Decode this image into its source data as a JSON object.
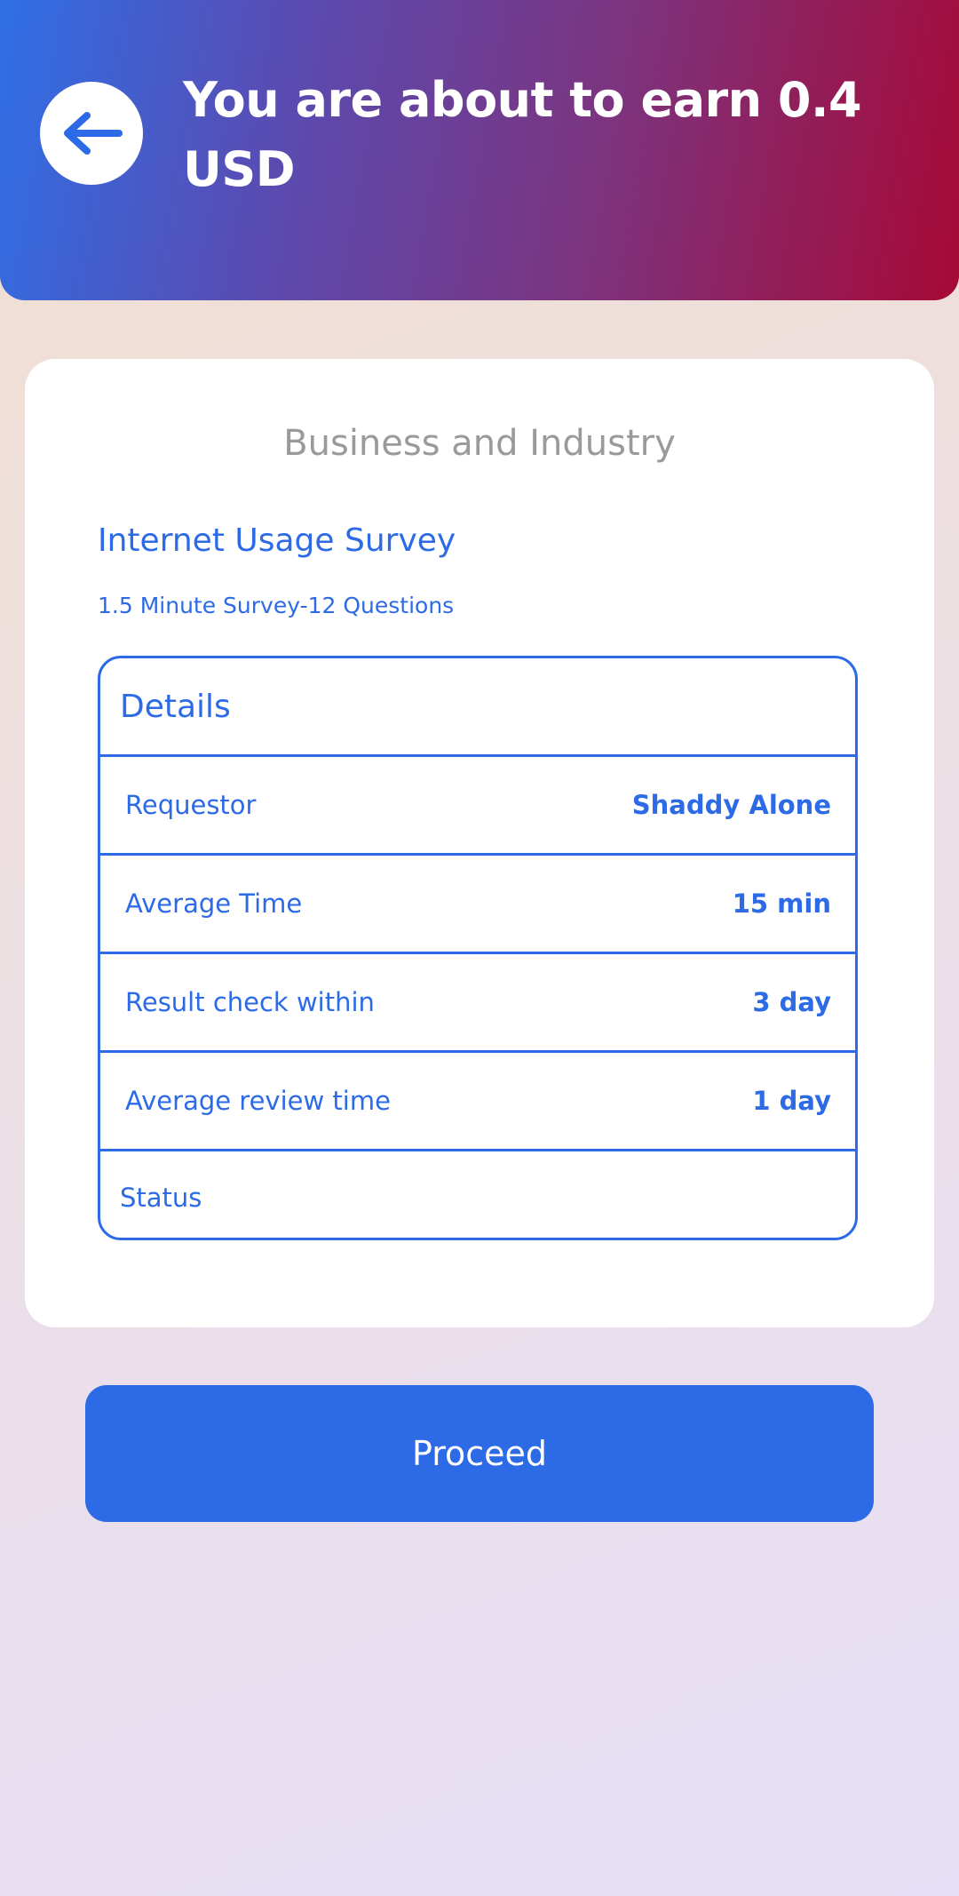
{
  "header": {
    "title": "You are about to earn 0.4 USD",
    "back_icon": "arrow-left-icon",
    "gradient_colors": [
      "#2f6fe6",
      "#a70936"
    ]
  },
  "card": {
    "category": "Business and Industry",
    "survey_title": "Internet Usage Survey",
    "survey_subtitle": "1.5 Minute Survey-12 Questions",
    "details": {
      "heading": "Details",
      "rows": [
        {
          "label": "Requestor",
          "value": "Shaddy Alone"
        },
        {
          "label": "Average Time",
          "value": "15 min"
        },
        {
          "label": "Result check within",
          "value": "3 day"
        },
        {
          "label": "Average review time",
          "value": "1 day"
        },
        {
          "label": "Status",
          "value": ""
        }
      ]
    }
  },
  "actions": {
    "proceed_label": "Proceed"
  },
  "colors": {
    "accent": "#2d6ae6",
    "muted_text": "#9a9a9a"
  }
}
